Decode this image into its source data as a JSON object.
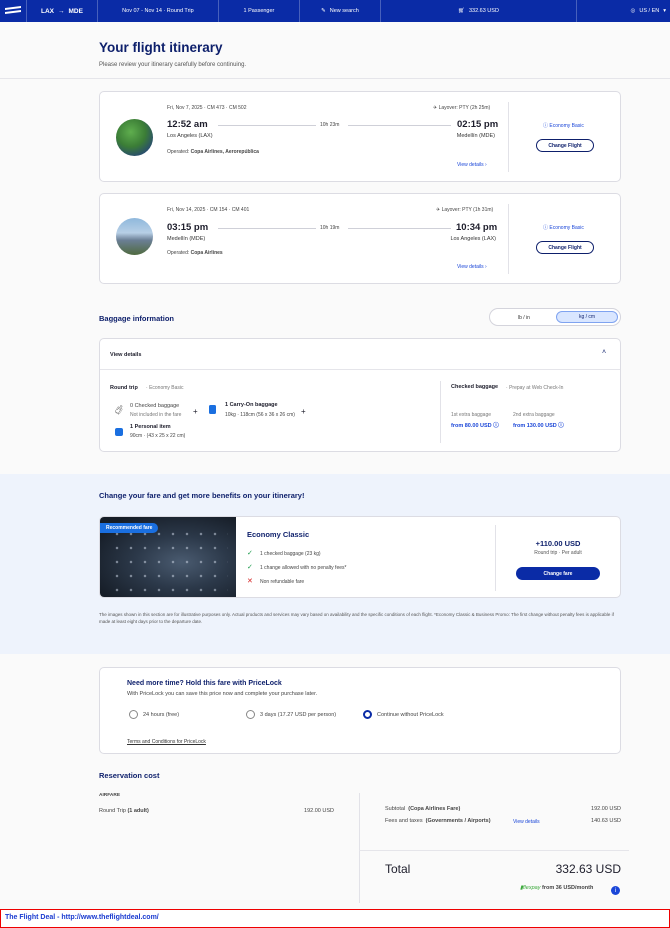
{
  "header": {
    "origin": "LAX",
    "arrow": "→",
    "destination": "MDE",
    "dates": "Nov 07 - Nov 14 · Round Trip",
    "passengers": "1 Passenger",
    "new_search": "New search",
    "total": "332.63 USD",
    "locale": "US / EN"
  },
  "page": {
    "title": "Your flight itinerary",
    "subtitle": "Please review your itinerary carefully before continuing."
  },
  "flights": [
    {
      "meta": "Fri, Nov 7, 2025 · CM 473 · CM 502",
      "layover": "Layover: PTY (2h 25m)",
      "depart_time": "12:52 am",
      "depart_city": "Los Angeles (LAX)",
      "duration": "10h 23m",
      "arrive_time": "02:15 pm",
      "arrive_city": "Medellín (MDE)",
      "operated_label": "Operated:",
      "operated_by": "Copa Airlines, Aerorepública",
      "view_details": "View details",
      "fare": "Economy Basic",
      "change": "Change Flight"
    },
    {
      "meta": "Fri, Nov 14, 2025 · CM 154 · CM 401",
      "layover": "Layover: PTY (1h 31m)",
      "depart_time": "03:15 pm",
      "depart_city": "Medellín (MDE)",
      "duration": "10h 19m",
      "arrive_time": "10:34 pm",
      "arrive_city": "Los Angeles (LAX)",
      "operated_label": "Operated:",
      "operated_by": "Copa Airlines",
      "view_details": "View details",
      "fare": "Economy Basic",
      "change": "Change Flight"
    }
  ],
  "baggage": {
    "title": "Baggage information",
    "unit_lb": "lb / in",
    "unit_kg": "kg / cm",
    "view_details": "View details",
    "round_trip": "Round trip",
    "fare_class": "Economy Basic",
    "checked_count": "0 Checked baggage",
    "checked_note": "Not included in the fare",
    "carry_on": "1 Carry-On baggage",
    "carry_on_dims": "10kg · 118cm (56 x 36 x 26 cm)",
    "personal": "1 Personal item",
    "personal_dims": "90cm · (43 x 25 x 22 cm)",
    "checked_title": "Checked baggage",
    "checked_sub": "Prepay at Web Check-In",
    "first_label": "1st extra baggage",
    "first_price": "from 80.00 USD",
    "second_label": "2nd extra baggage",
    "second_price": "from 130.00 USD"
  },
  "upgrade": {
    "title": "Change your fare and get more benefits on your itinerary!",
    "badge": "Recommended fare",
    "fare_name": "Economy Classic",
    "benefit1": "1 checked baggage (23 kg)",
    "benefit2": "1 change allowed with no penalty fees*",
    "benefit3": "Non refundable fare",
    "price": "+110.00 USD",
    "price_note": "Round trip · Per adult",
    "button": "Change fare",
    "disclaimer": "The images shown in this section are for illustrative purposes only. Actual products and services may vary based on availability and the specific conditions of each flight. *Economy Classic & Business Promo: The first change without penalty fees is applicable if made at least eight days prior to the departure date."
  },
  "pricelock": {
    "title": "Need more time? Hold this fare with PriceLock",
    "subtitle": "With PriceLock you can save this price now and complete your purchase later.",
    "opt1": "24 hours (free)",
    "opt2": "3 days (17.27 USD per person)",
    "opt3": "Continue without PriceLock",
    "terms": "Terms and Conditions for PriceLock"
  },
  "cost": {
    "title": "Reservation cost",
    "airfare": "AIRFARE",
    "round_trip_label": "Round Trip",
    "adults": "(1 adult)",
    "round_trip_price": "192.00 USD",
    "subtotal_label": "Subtotal",
    "subtotal_note": "(Copa Airlines Fare)",
    "subtotal_price": "192.00 USD",
    "taxes_label": "Fees and taxes",
    "taxes_note": "(Governments / Airports)",
    "taxes_link": "View details",
    "taxes_price": "140.63 USD",
    "total_label": "Total",
    "total_price": "332.63 USD",
    "flexpay_brand": "flexpay",
    "flexpay_text": "from 36 USD/month"
  },
  "footer": {
    "text": "The Flight Deal - http://www.theflightdeal.com/"
  },
  "colors": {
    "brand": "#0a2ba6",
    "title": "#0d1f6b",
    "link": "#1a46d8",
    "upgrade_bg": "#eef3fc"
  }
}
